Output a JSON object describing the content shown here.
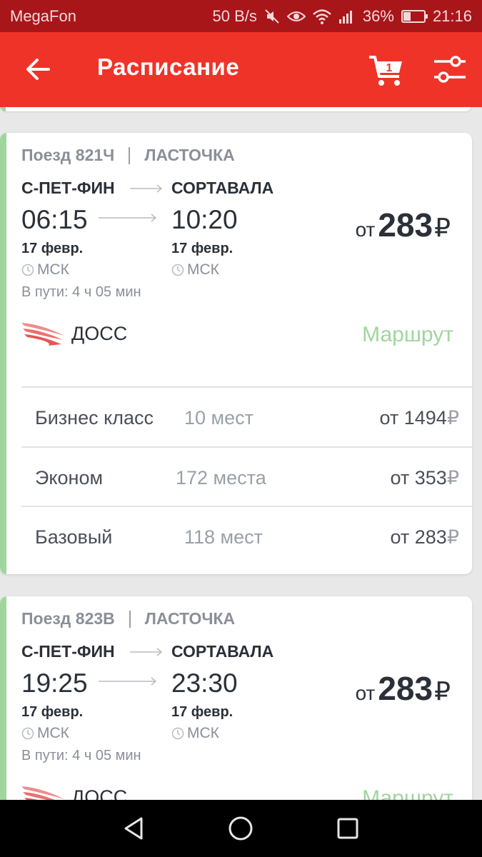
{
  "status_bar": {
    "carrier": "MegaFon",
    "speed": "50 B/s",
    "battery": "36%",
    "battery_level": 0.36,
    "time": "21:16"
  },
  "toolbar": {
    "title": "Расписание",
    "cart_count": "1"
  },
  "trains": [
    {
      "train_label": "Поезд 821Ч",
      "train_type": "ЛАСТОЧКА",
      "from_station": "С-ПЕТ-ФИН",
      "to_station": "СОРТАВАЛА",
      "dep_time": "06:15",
      "arr_time": "10:20",
      "dep_date": "17 февр.",
      "arr_date": "17 февр.",
      "dep_tz": "МСК",
      "arr_tz": "МСК",
      "duration": "В пути: 4 ч 05 мин",
      "price_prefix": "от",
      "price": "283",
      "currency": "₽",
      "carrier": "ДОСС",
      "route_link": "Маршрут",
      "classes": [
        {
          "name": "Бизнес класс",
          "seats": "10 мест",
          "price": "от 1494",
          "currency": "₽"
        },
        {
          "name": "Эконом",
          "seats": "172 места",
          "price": "от 353",
          "currency": "₽"
        },
        {
          "name": "Базовый",
          "seats": "118 мест",
          "price": "от 283",
          "currency": "₽"
        }
      ]
    },
    {
      "train_label": "Поезд 823В",
      "train_type": "ЛАСТОЧКА",
      "from_station": "С-ПЕТ-ФИН",
      "to_station": "СОРТАВАЛА",
      "dep_time": "19:25",
      "arr_time": "23:30",
      "dep_date": "17 февр.",
      "arr_date": "17 февр.",
      "dep_tz": "МСК",
      "arr_tz": "МСК",
      "duration": "В пути: 4 ч 05 мин",
      "price_prefix": "от",
      "price": "283",
      "currency": "₽",
      "carrier": "ДОСС",
      "route_link": "Маршрут"
    }
  ],
  "colors": {
    "status_bar": "#a8161a",
    "toolbar": "#ef3328",
    "accent_green": "#9fd69e",
    "text_dark": "#2b3038",
    "text_muted": "#8a8f98"
  },
  "icons": {
    "back": "arrow-left-icon",
    "cart": "cart-icon",
    "filter": "sliders-icon",
    "clock": "clock-icon",
    "nav_back": "triangle-back-icon",
    "nav_home": "circle-home-icon",
    "nav_recent": "square-recent-icon"
  }
}
